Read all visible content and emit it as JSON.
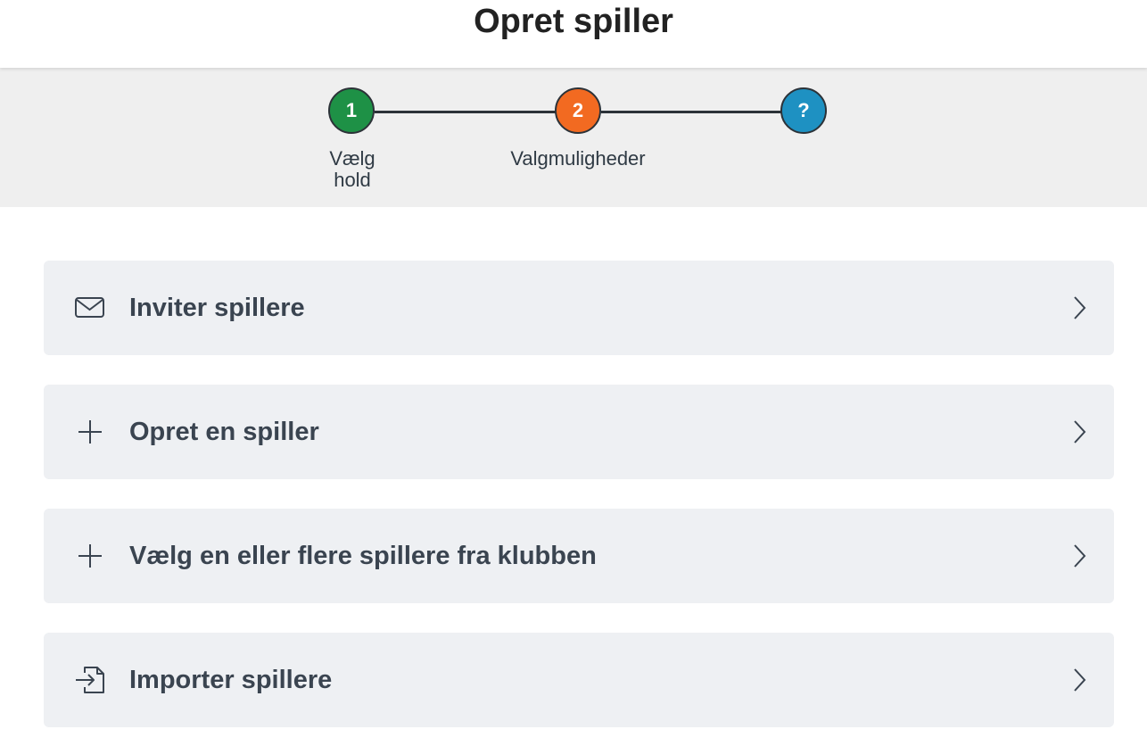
{
  "header": {
    "title": "Opret spiller"
  },
  "stepper": {
    "steps": [
      {
        "number": "1",
        "label": "Vælg hold",
        "color": "#1e9146",
        "state": "completed"
      },
      {
        "number": "2",
        "label": "Valgmuligheder",
        "color": "#f26a21",
        "state": "current"
      },
      {
        "number": "?",
        "label": "",
        "color": "#1e91c2",
        "state": "upcoming"
      }
    ]
  },
  "options": [
    {
      "label": "Inviter spillere",
      "icon": "envelope-icon"
    },
    {
      "label": "Opret en spiller",
      "icon": "plus-icon"
    },
    {
      "label": "Vælg en eller flere spillere fra klubben",
      "icon": "plus-icon"
    },
    {
      "label": "Importer spillere",
      "icon": "file-import-icon"
    }
  ],
  "colors": {
    "step_done": "#1e9146",
    "step_current": "#f26a21",
    "step_upcoming": "#1e91c2",
    "card_background": "#eef0f3",
    "band_background": "#efefef"
  }
}
